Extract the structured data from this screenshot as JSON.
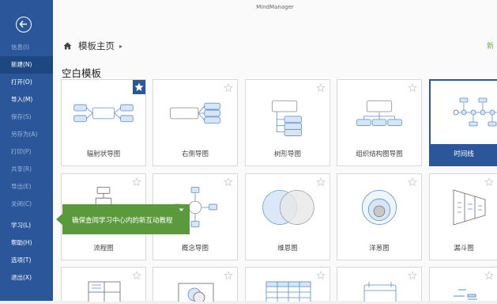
{
  "app": {
    "title": "MindManager"
  },
  "sidebar": {
    "items": [
      {
        "label": "信息(I)",
        "state": "disabled"
      },
      {
        "label": "新建(N)",
        "state": "selected"
      },
      {
        "label": "打开(O)",
        "state": "normal"
      },
      {
        "label": "导入(M)",
        "state": "normal"
      },
      {
        "label": "保存(S)",
        "state": "disabled"
      },
      {
        "label": "另存为(A)",
        "state": "disabled"
      },
      {
        "label": "打印(P)",
        "state": "disabled"
      },
      {
        "label": "共享(R)",
        "state": "disabled"
      },
      {
        "label": "导出(E)",
        "state": "disabled"
      },
      {
        "label": "关闭(C)",
        "state": "disabled"
      },
      {
        "label": "学习(L)",
        "state": "normal"
      },
      {
        "label": "帮助(H)",
        "state": "normal"
      },
      {
        "label": "选项(T)",
        "state": "normal"
      },
      {
        "label": "退出(X)",
        "state": "normal"
      }
    ]
  },
  "breadcrumb": {
    "label": "模板主页"
  },
  "right_link": {
    "label": "新"
  },
  "section": {
    "title": "空白模板"
  },
  "templates": [
    {
      "label": "辐射状导图"
    },
    {
      "label": "右侧导图"
    },
    {
      "label": "树形导图"
    },
    {
      "label": "组织结构图导图"
    },
    {
      "label": "时间线"
    },
    {
      "label": "流程图"
    },
    {
      "label": "概念导图"
    },
    {
      "label": "维恩图"
    },
    {
      "label": "洋葱图"
    },
    {
      "label": "漏斗图"
    }
  ],
  "tooltip": {
    "text": "确保查阅学习中心内的新互动教程"
  },
  "colors": {
    "sidebar": "#2b579a",
    "thumb_stroke": "#5b8fc7",
    "thumb_fill": "#d6e6f7",
    "tooltip": "#5b9a3c"
  }
}
